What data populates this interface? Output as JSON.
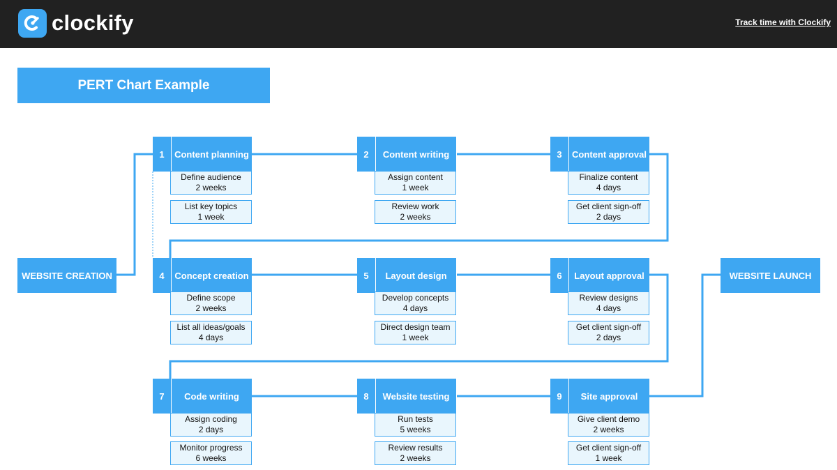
{
  "header": {
    "brand": "clockify",
    "link_label": "Track time with Clockify",
    "colors": {
      "bar": "#212121",
      "accent": "#3ea7f2"
    }
  },
  "title": "PERT Chart Example",
  "start_label": "WEBSITE CREATION",
  "end_label": "WEBSITE LAUNCH",
  "tasks": [
    {
      "num": "1",
      "name": "Content planning",
      "subtasks": [
        {
          "name": "Define audience",
          "duration": "2 weeks"
        },
        {
          "name": "List key topics",
          "duration": "1 week"
        }
      ]
    },
    {
      "num": "2",
      "name": "Content writing",
      "subtasks": [
        {
          "name": "Assign content",
          "duration": "1 week"
        },
        {
          "name": "Review work",
          "duration": "2 weeks"
        }
      ]
    },
    {
      "num": "3",
      "name": "Content approval",
      "subtasks": [
        {
          "name": "Finalize content",
          "duration": "4 days"
        },
        {
          "name": "Get client sign-off",
          "duration": "2 days"
        }
      ]
    },
    {
      "num": "4",
      "name": "Concept creation",
      "subtasks": [
        {
          "name": "Define scope",
          "duration": "2 weeks"
        },
        {
          "name": "List all ideas/goals",
          "duration": "4 days"
        }
      ]
    },
    {
      "num": "5",
      "name": "Layout design",
      "subtasks": [
        {
          "name": "Develop concepts",
          "duration": "4 days"
        },
        {
          "name": "Direct design team",
          "duration": "1 week"
        }
      ]
    },
    {
      "num": "6",
      "name": "Layout approval",
      "subtasks": [
        {
          "name": "Review designs",
          "duration": "4 days"
        },
        {
          "name": "Get client sign-off",
          "duration": "2 days"
        }
      ]
    },
    {
      "num": "7",
      "name": "Code writing",
      "subtasks": [
        {
          "name": "Assign coding",
          "duration": "2 days"
        },
        {
          "name": "Monitor progress",
          "duration": "6 weeks"
        }
      ]
    },
    {
      "num": "8",
      "name": "Website testing",
      "subtasks": [
        {
          "name": "Run tests",
          "duration": "5 weeks"
        },
        {
          "name": "Review results",
          "duration": "2 weeks"
        }
      ]
    },
    {
      "num": "9",
      "name": "Site approval",
      "subtasks": [
        {
          "name": "Give client demo",
          "duration": "2 weeks"
        },
        {
          "name": "Get client sign-off",
          "duration": "1 week"
        }
      ]
    }
  ]
}
